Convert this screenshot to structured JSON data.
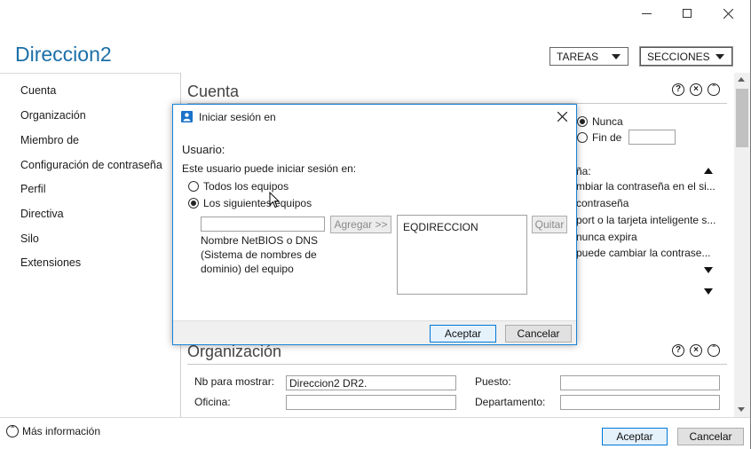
{
  "window": {
    "title": "Direccion2",
    "tasks_label": "TAREAS",
    "sections_label": "SECCIONES",
    "icons": {
      "minimize": "minimize-icon",
      "maximize": "maximize-icon",
      "close": "close-icon"
    }
  },
  "nav": {
    "items": [
      {
        "label": "Cuenta"
      },
      {
        "label": "Organización"
      },
      {
        "label": "Miembro de"
      },
      {
        "label": "Configuración de contraseña"
      },
      {
        "label": "Perfil"
      },
      {
        "label": "Directiva"
      },
      {
        "label": "Silo"
      },
      {
        "label": "Extensiones"
      }
    ]
  },
  "cuenta": {
    "title": "Cuenta",
    "expires_never": "Nunca",
    "expires_at": "Fin de",
    "password_options_label": "ña:",
    "options": [
      "mbiar la contraseña en el si...",
      "contraseña",
      "port o la tarjeta inteligente s...",
      "nunca expira",
      "puede cambiar la contrase..."
    ]
  },
  "organizacion": {
    "title": "Organización",
    "display_name_label": "Nb para mostrar:",
    "display_name_value": "Direccion2 DR2.",
    "office_label": "Oficina:",
    "office_value": "",
    "job_title_label": "Puesto:",
    "job_title_value": "",
    "department_label": "Departamento:",
    "department_value": ""
  },
  "dialog": {
    "title": "Iniciar sesión en",
    "user_heading": "Usuario:",
    "description": "Este usuario puede iniciar sesión en:",
    "option_all": "Todos los equipos",
    "option_following": "Los siguientes equipos",
    "selected_option": "Los siguientes equipos",
    "computer_input_value": "",
    "hint": "Nombre NetBIOS o DNS (Sistema de nombres de dominio) del equipo",
    "add_button": "Agregar >>",
    "remove_button": "Quitar",
    "computers": [
      "EQDIRECCION"
    ],
    "ok_button": "Aceptar",
    "cancel_button": "Cancelar"
  },
  "footer": {
    "more_info": "Más información",
    "ok_button": "Aceptar",
    "cancel_button": "Cancelar"
  },
  "colors": {
    "title": "#1b6fa8",
    "dialog_border": "#1883d7",
    "accent": "#0078d7"
  }
}
